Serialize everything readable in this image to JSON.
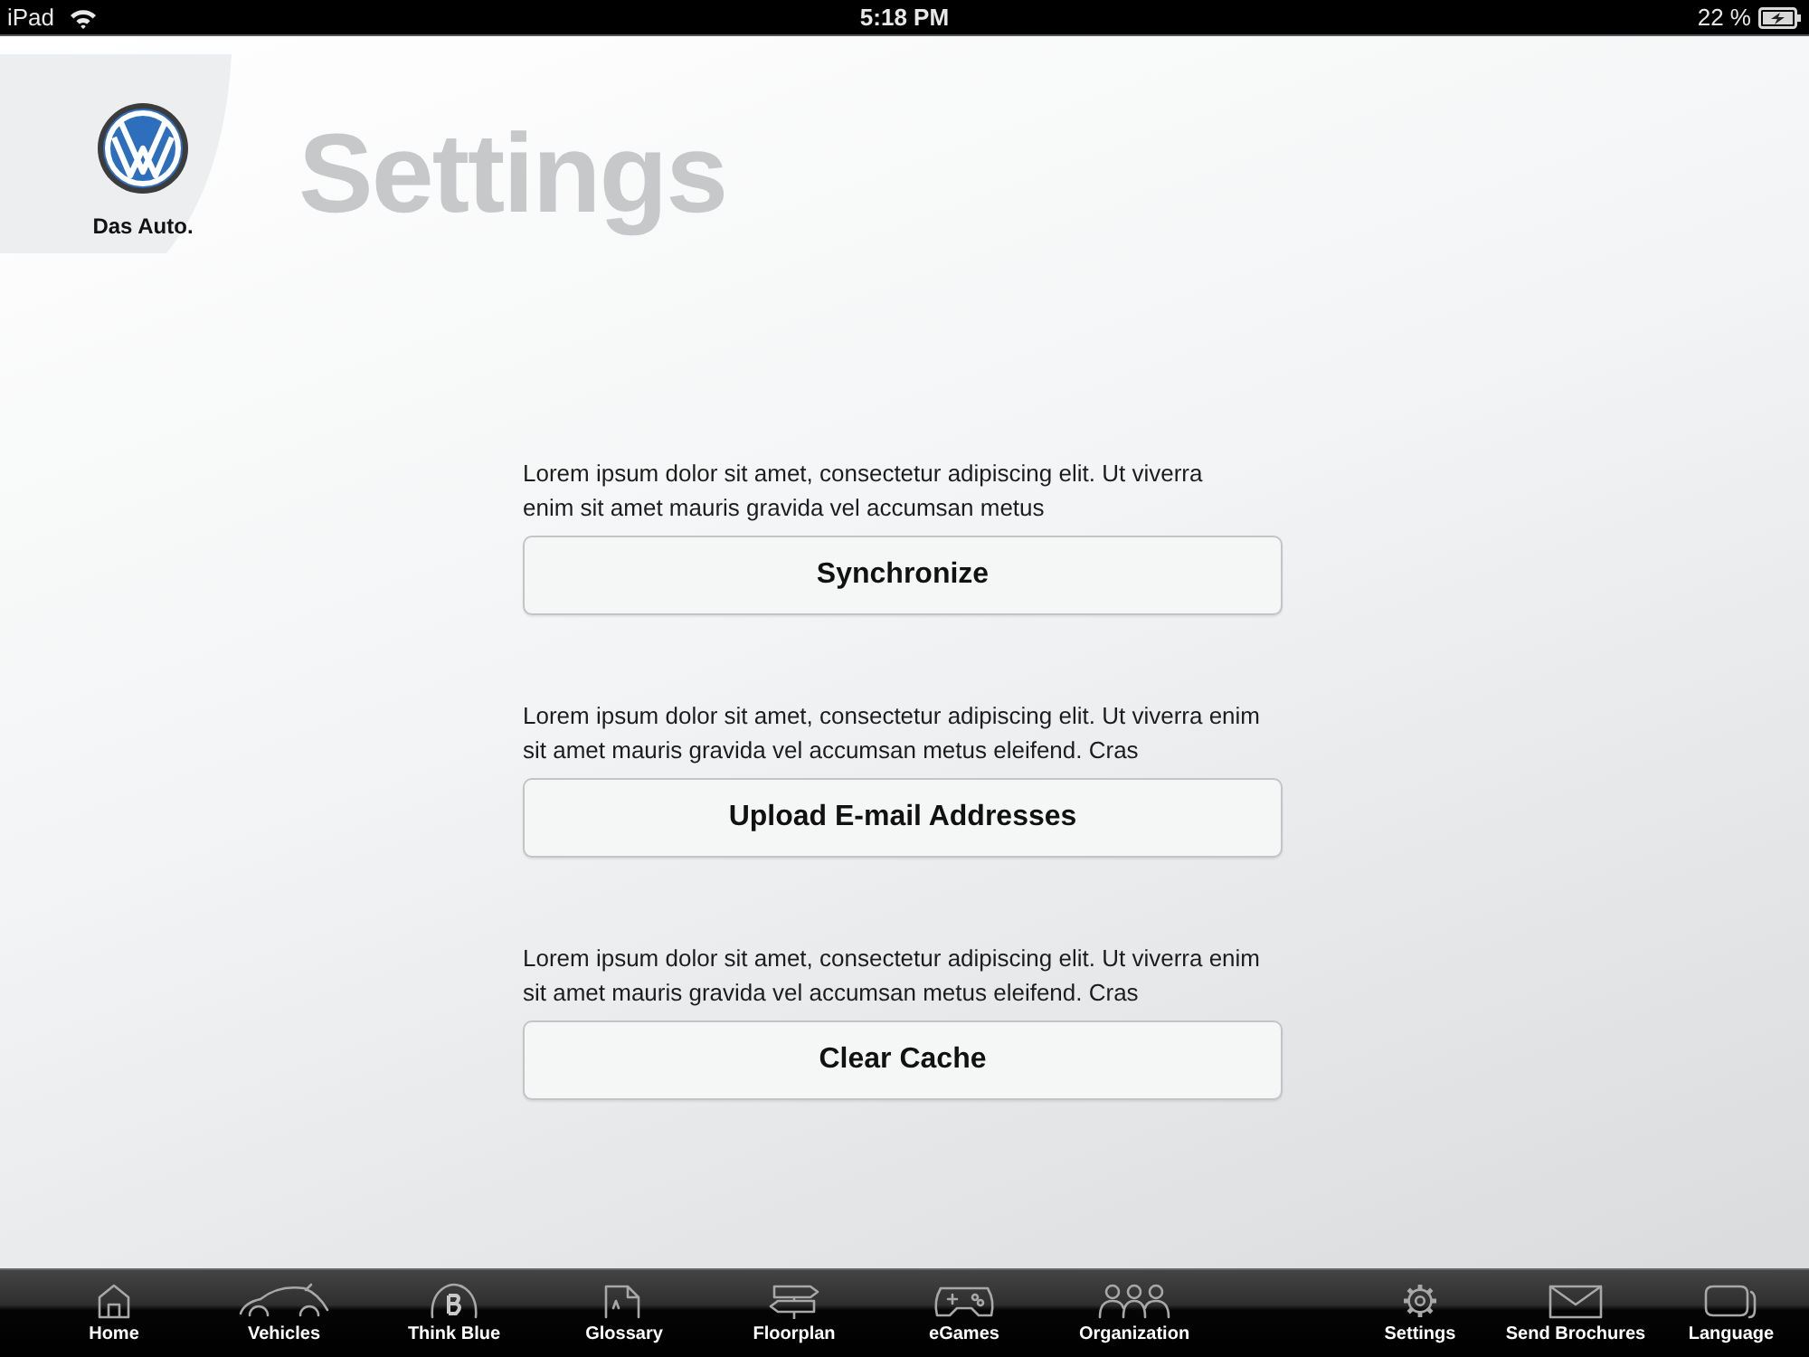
{
  "status_bar": {
    "device": "iPad",
    "time": "5:18 PM",
    "battery": "22 %"
  },
  "brand": {
    "tagline": "Das Auto."
  },
  "page": {
    "title": "Settings"
  },
  "sections": [
    {
      "description": "Lorem ipsum dolor sit amet, consectetur adipiscing elit. Ut viverra enim sit amet mauris gravida vel accumsan metus",
      "button": "Synchronize"
    },
    {
      "description": "Lorem ipsum dolor sit amet, consectetur adipiscing elit. Ut viverra enim sit amet mauris gravida vel accumsan metus eleifend. Cras",
      "button": "Upload E-mail Addresses"
    },
    {
      "description": "Lorem ipsum dolor sit amet, consectetur adipiscing elit. Ut viverra enim sit amet mauris gravida vel accumsan metus eleifend. Cras",
      "button": "Clear Cache"
    }
  ],
  "tab_bar": {
    "left_items": [
      "Home",
      "Vehicles",
      "Think Blue",
      "Glossary",
      "Floorplan",
      "eGames",
      "Organization"
    ],
    "right_items": [
      "Settings",
      "Send Brochures",
      "Language"
    ]
  }
}
